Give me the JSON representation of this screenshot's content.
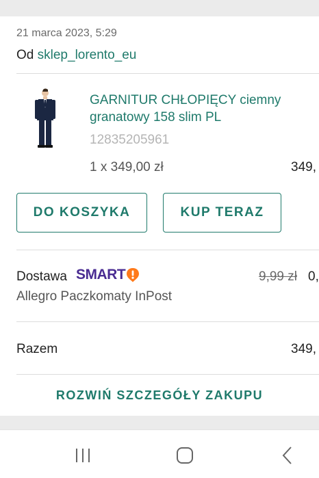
{
  "order": {
    "date": "21 marca 2023, 5:29",
    "seller_prefix": "Od",
    "seller_name": "sklep_lorento_eu"
  },
  "product": {
    "title": "GARNITUR CHŁOPIĘCY ciemny granatowy 158 slim PL",
    "offer_id": "12835205961",
    "quantity_price": "1 x 349,00 zł",
    "line_total": "349,"
  },
  "actions": {
    "add_to_cart": "DO KOSZYKA",
    "buy_now": "KUP TERAZ"
  },
  "delivery": {
    "label": "Dostawa",
    "badge_text": "SMART",
    "old_price": "9,99 zł",
    "new_price": "0,",
    "method": "Allegro Paczkomaty InPost"
  },
  "summary": {
    "total_label": "Razem",
    "total_value": "349,"
  },
  "footer": {
    "expand_label": "ROZWIŃ SZCZEGÓŁY ZAKUPU"
  },
  "navigation": {
    "icons": [
      "recent-apps-icon",
      "home-icon",
      "back-icon"
    ]
  },
  "colors": {
    "accent": "#1f7a6b",
    "smart_purple": "#4a2c92",
    "smart_orange": "#ff7a1a",
    "background": "#ebebeb"
  }
}
